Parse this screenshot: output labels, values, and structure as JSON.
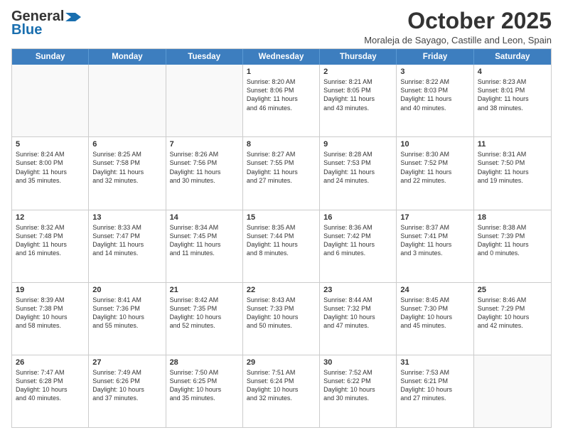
{
  "header": {
    "logo_line1": "General",
    "logo_line2": "Blue",
    "month_title": "October 2025",
    "subtitle": "Moraleja de Sayago, Castille and Leon, Spain"
  },
  "weekdays": [
    "Sunday",
    "Monday",
    "Tuesday",
    "Wednesday",
    "Thursday",
    "Friday",
    "Saturday"
  ],
  "rows": [
    [
      {
        "day": "",
        "text": ""
      },
      {
        "day": "",
        "text": ""
      },
      {
        "day": "",
        "text": ""
      },
      {
        "day": "1",
        "text": "Sunrise: 8:20 AM\nSunset: 8:06 PM\nDaylight: 11 hours\nand 46 minutes."
      },
      {
        "day": "2",
        "text": "Sunrise: 8:21 AM\nSunset: 8:05 PM\nDaylight: 11 hours\nand 43 minutes."
      },
      {
        "day": "3",
        "text": "Sunrise: 8:22 AM\nSunset: 8:03 PM\nDaylight: 11 hours\nand 40 minutes."
      },
      {
        "day": "4",
        "text": "Sunrise: 8:23 AM\nSunset: 8:01 PM\nDaylight: 11 hours\nand 38 minutes."
      }
    ],
    [
      {
        "day": "5",
        "text": "Sunrise: 8:24 AM\nSunset: 8:00 PM\nDaylight: 11 hours\nand 35 minutes."
      },
      {
        "day": "6",
        "text": "Sunrise: 8:25 AM\nSunset: 7:58 PM\nDaylight: 11 hours\nand 32 minutes."
      },
      {
        "day": "7",
        "text": "Sunrise: 8:26 AM\nSunset: 7:56 PM\nDaylight: 11 hours\nand 30 minutes."
      },
      {
        "day": "8",
        "text": "Sunrise: 8:27 AM\nSunset: 7:55 PM\nDaylight: 11 hours\nand 27 minutes."
      },
      {
        "day": "9",
        "text": "Sunrise: 8:28 AM\nSunset: 7:53 PM\nDaylight: 11 hours\nand 24 minutes."
      },
      {
        "day": "10",
        "text": "Sunrise: 8:30 AM\nSunset: 7:52 PM\nDaylight: 11 hours\nand 22 minutes."
      },
      {
        "day": "11",
        "text": "Sunrise: 8:31 AM\nSunset: 7:50 PM\nDaylight: 11 hours\nand 19 minutes."
      }
    ],
    [
      {
        "day": "12",
        "text": "Sunrise: 8:32 AM\nSunset: 7:48 PM\nDaylight: 11 hours\nand 16 minutes."
      },
      {
        "day": "13",
        "text": "Sunrise: 8:33 AM\nSunset: 7:47 PM\nDaylight: 11 hours\nand 14 minutes."
      },
      {
        "day": "14",
        "text": "Sunrise: 8:34 AM\nSunset: 7:45 PM\nDaylight: 11 hours\nand 11 minutes."
      },
      {
        "day": "15",
        "text": "Sunrise: 8:35 AM\nSunset: 7:44 PM\nDaylight: 11 hours\nand 8 minutes."
      },
      {
        "day": "16",
        "text": "Sunrise: 8:36 AM\nSunset: 7:42 PM\nDaylight: 11 hours\nand 6 minutes."
      },
      {
        "day": "17",
        "text": "Sunrise: 8:37 AM\nSunset: 7:41 PM\nDaylight: 11 hours\nand 3 minutes."
      },
      {
        "day": "18",
        "text": "Sunrise: 8:38 AM\nSunset: 7:39 PM\nDaylight: 11 hours\nand 0 minutes."
      }
    ],
    [
      {
        "day": "19",
        "text": "Sunrise: 8:39 AM\nSunset: 7:38 PM\nDaylight: 10 hours\nand 58 minutes."
      },
      {
        "day": "20",
        "text": "Sunrise: 8:41 AM\nSunset: 7:36 PM\nDaylight: 10 hours\nand 55 minutes."
      },
      {
        "day": "21",
        "text": "Sunrise: 8:42 AM\nSunset: 7:35 PM\nDaylight: 10 hours\nand 52 minutes."
      },
      {
        "day": "22",
        "text": "Sunrise: 8:43 AM\nSunset: 7:33 PM\nDaylight: 10 hours\nand 50 minutes."
      },
      {
        "day": "23",
        "text": "Sunrise: 8:44 AM\nSunset: 7:32 PM\nDaylight: 10 hours\nand 47 minutes."
      },
      {
        "day": "24",
        "text": "Sunrise: 8:45 AM\nSunset: 7:30 PM\nDaylight: 10 hours\nand 45 minutes."
      },
      {
        "day": "25",
        "text": "Sunrise: 8:46 AM\nSunset: 7:29 PM\nDaylight: 10 hours\nand 42 minutes."
      }
    ],
    [
      {
        "day": "26",
        "text": "Sunrise: 7:47 AM\nSunset: 6:28 PM\nDaylight: 10 hours\nand 40 minutes."
      },
      {
        "day": "27",
        "text": "Sunrise: 7:49 AM\nSunset: 6:26 PM\nDaylight: 10 hours\nand 37 minutes."
      },
      {
        "day": "28",
        "text": "Sunrise: 7:50 AM\nSunset: 6:25 PM\nDaylight: 10 hours\nand 35 minutes."
      },
      {
        "day": "29",
        "text": "Sunrise: 7:51 AM\nSunset: 6:24 PM\nDaylight: 10 hours\nand 32 minutes."
      },
      {
        "day": "30",
        "text": "Sunrise: 7:52 AM\nSunset: 6:22 PM\nDaylight: 10 hours\nand 30 minutes."
      },
      {
        "day": "31",
        "text": "Sunrise: 7:53 AM\nSunset: 6:21 PM\nDaylight: 10 hours\nand 27 minutes."
      },
      {
        "day": "",
        "text": ""
      }
    ]
  ]
}
